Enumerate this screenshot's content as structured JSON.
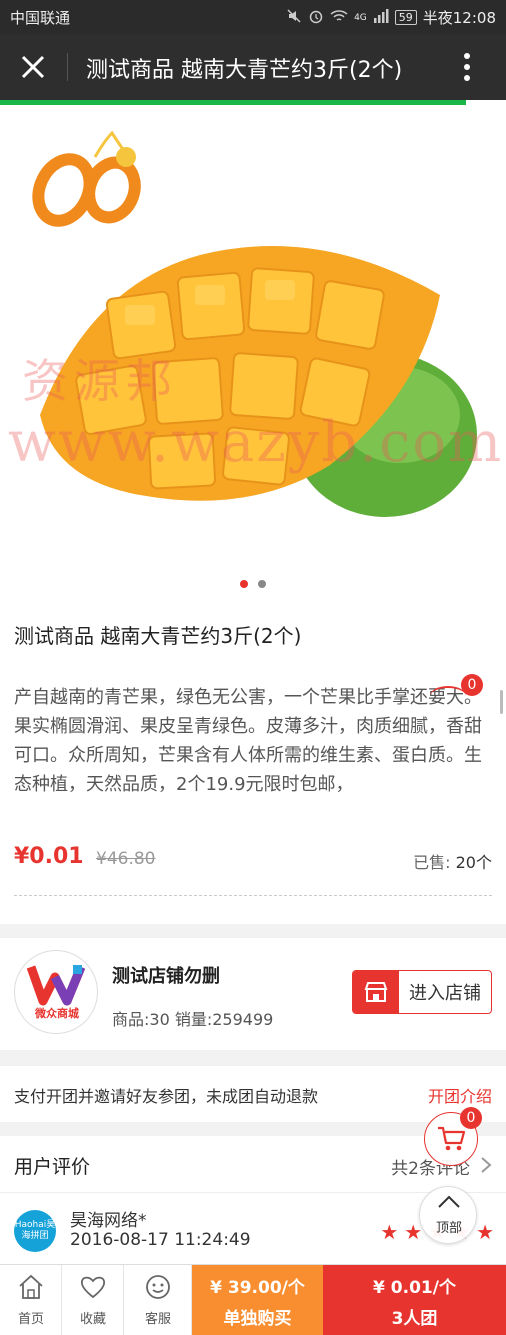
{
  "status_bar": {
    "carrier": "中国联通",
    "battery": "59",
    "time": "半夜12:08",
    "network": "4G"
  },
  "header": {
    "title": "测试商品 越南大青芒约3斤(2个)"
  },
  "hero": {
    "watermark_line1": "资源邦",
    "watermark_line2": "www.wazyb.com",
    "slide_count": 2,
    "active_slide": 1
  },
  "product": {
    "title": "测试商品 越南大青芒约3斤(2个)",
    "description": "产自越南的青芒果，绿色无公害，一个芒果比手掌还要大。果实椭圆滑润、果皮呈青绿色。皮薄多汁，肉质细腻，香甜可口。众所周知，芒果含有人体所需的维生素、蛋白质。生态种植，天然品质，2个19.9元限时包邮，",
    "price": "¥0.01",
    "original_price": "¥46.80",
    "sold_label": "已售:",
    "sold_count": "20个"
  },
  "shop": {
    "name": "测试店铺勿删",
    "stats": "商品:30 销量:259499",
    "enter_label": "进入店铺",
    "logo_text": "微众商城"
  },
  "group_rule": {
    "text": "支付开团并邀请好友参团，未成团自动退款",
    "link": "开团介绍"
  },
  "reviews": {
    "heading": "用户评价",
    "count": "共2条评论",
    "items": [
      {
        "user": "昊海网络*",
        "date": "2016-08-17 11:24:49",
        "avatar_text": "Haohai昊海拼团",
        "stars": 5
      }
    ]
  },
  "floating": {
    "cart_badge_top": "0",
    "cart_badge": "0",
    "back_top_label": "顶部"
  },
  "bottom_bar": {
    "home": "首页",
    "favorite": "收藏",
    "service": "客服",
    "solo_price": "¥ 39.00/个",
    "solo_label": "单独购买",
    "group_price": "¥ 0.01/个",
    "group_label": "3人团"
  },
  "colors": {
    "accent": "#e8342f",
    "orange": "#f88e2f",
    "progress": "#19b64a",
    "topbar": "#2e2e2e"
  }
}
